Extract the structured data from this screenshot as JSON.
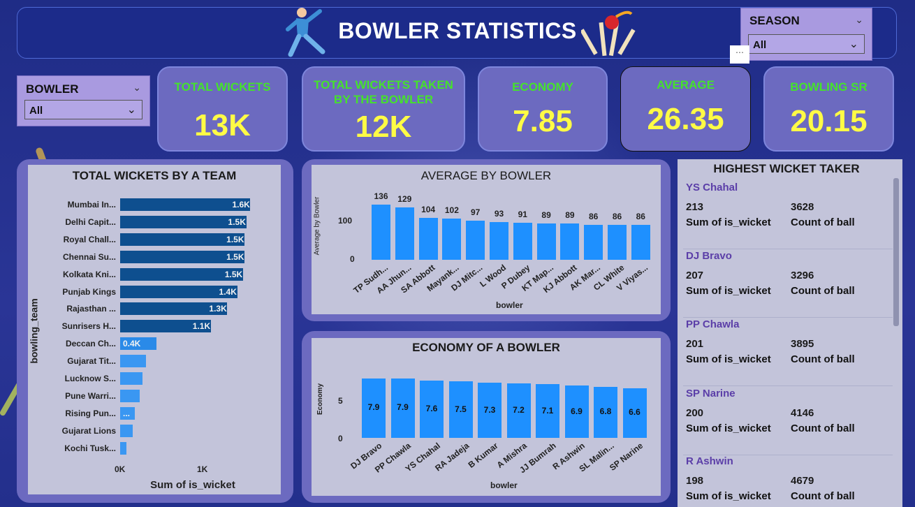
{
  "header": {
    "title": "BOWLER STATISTICS"
  },
  "season_slicer": {
    "label": "SEASON",
    "value": "All"
  },
  "bowler_slicer": {
    "label": "BOWLER",
    "value": "All"
  },
  "kpis": {
    "total_wickets": {
      "label": "TOTAL WICKETS",
      "value": "13K"
    },
    "wickets_by_bowler": {
      "label": "TOTAL WICKETS TAKEN BY THE BOWLER",
      "value": "12K"
    },
    "economy": {
      "label": "ECONOMY",
      "value": "7.85"
    },
    "average": {
      "label": "AVERAGE",
      "value": "26.35"
    },
    "strike_rate": {
      "label": "BOWLING SR",
      "value": "20.15"
    }
  },
  "colors": {
    "bar_dark": "#0e4f8f",
    "bar_light": "#1e90ff",
    "kpi_label": "#45e22c",
    "kpi_value": "#fffb45"
  },
  "chart_data": [
    {
      "type": "bar",
      "orientation": "horizontal",
      "title": "TOTAL WICKETS BY A TEAM",
      "xlabel": "Sum of is_wicket",
      "ylabel": "bowling_team",
      "xticks": [
        "0K",
        "1K"
      ],
      "categories": [
        "Mumbai In...",
        "Delhi Capit...",
        "Royal Chall...",
        "Chennai Su...",
        "Kolkata Kni...",
        "Punjab Kings",
        "Rajasthan ...",
        "Sunrisers H...",
        "Deccan Ch...",
        "Gujarat Tit...",
        "Lucknow S...",
        "Pune Warri...",
        "Rising Pun...",
        "Gujarat Lions",
        "Kochi Tusk..."
      ],
      "values": [
        1580,
        1530,
        1510,
        1510,
        1490,
        1420,
        1300,
        1100,
        440,
        310,
        270,
        240,
        180,
        150,
        80
      ],
      "data_labels": [
        "1.6K",
        "1.5K",
        "1.5K",
        "1.5K",
        "1.5K",
        "1.4K",
        "1.3K",
        "1.1K",
        "0.4K",
        "",
        "",
        "",
        "...",
        "",
        ""
      ]
    },
    {
      "type": "bar",
      "title": "AVERAGE BY BOWLER",
      "xlabel": "bowler",
      "ylabel": "Average by Bowler",
      "yticks": [
        "0",
        "100"
      ],
      "categories": [
        "TP Sudh...",
        "AA Jhun...",
        "SA Abbott",
        "Mayank...",
        "DJ Mitc...",
        "L Wood",
        "P Dubey",
        "KT Map...",
        "KJ Abbott",
        "AK Mar...",
        "CL White",
        "V Viyas..."
      ],
      "values": [
        136,
        129,
        104,
        102,
        97,
        93,
        91,
        89,
        89,
        86,
        86,
        86
      ]
    },
    {
      "type": "bar",
      "title": "ECONOMY OF A BOWLER",
      "xlabel": "bowler",
      "ylabel": "Economy",
      "yticks": [
        "0",
        "5"
      ],
      "categories": [
        "DJ Bravo",
        "PP Chawla",
        "YS Chahal",
        "RA Jadeja",
        "B Kumar",
        "A Mishra",
        "JJ Bumrah",
        "R Ashwin",
        "SL Malin...",
        "SP Narine"
      ],
      "values": [
        7.9,
        7.9,
        7.6,
        7.5,
        7.3,
        7.2,
        7.1,
        6.9,
        6.8,
        6.6
      ]
    }
  ],
  "wicket_takers": {
    "title": "HIGHEST WICKET TAKER",
    "wicket_label": "Sum of is_wicket",
    "ball_label": "Count of ball",
    "items": [
      {
        "name": "YS Chahal",
        "wickets": "213",
        "balls": "3628"
      },
      {
        "name": "DJ Bravo",
        "wickets": "207",
        "balls": "3296"
      },
      {
        "name": "PP Chawla",
        "wickets": "201",
        "balls": "3895"
      },
      {
        "name": "SP Narine",
        "wickets": "200",
        "balls": "4146"
      },
      {
        "name": "R Ashwin",
        "wickets": "198",
        "balls": "4679"
      }
    ]
  }
}
